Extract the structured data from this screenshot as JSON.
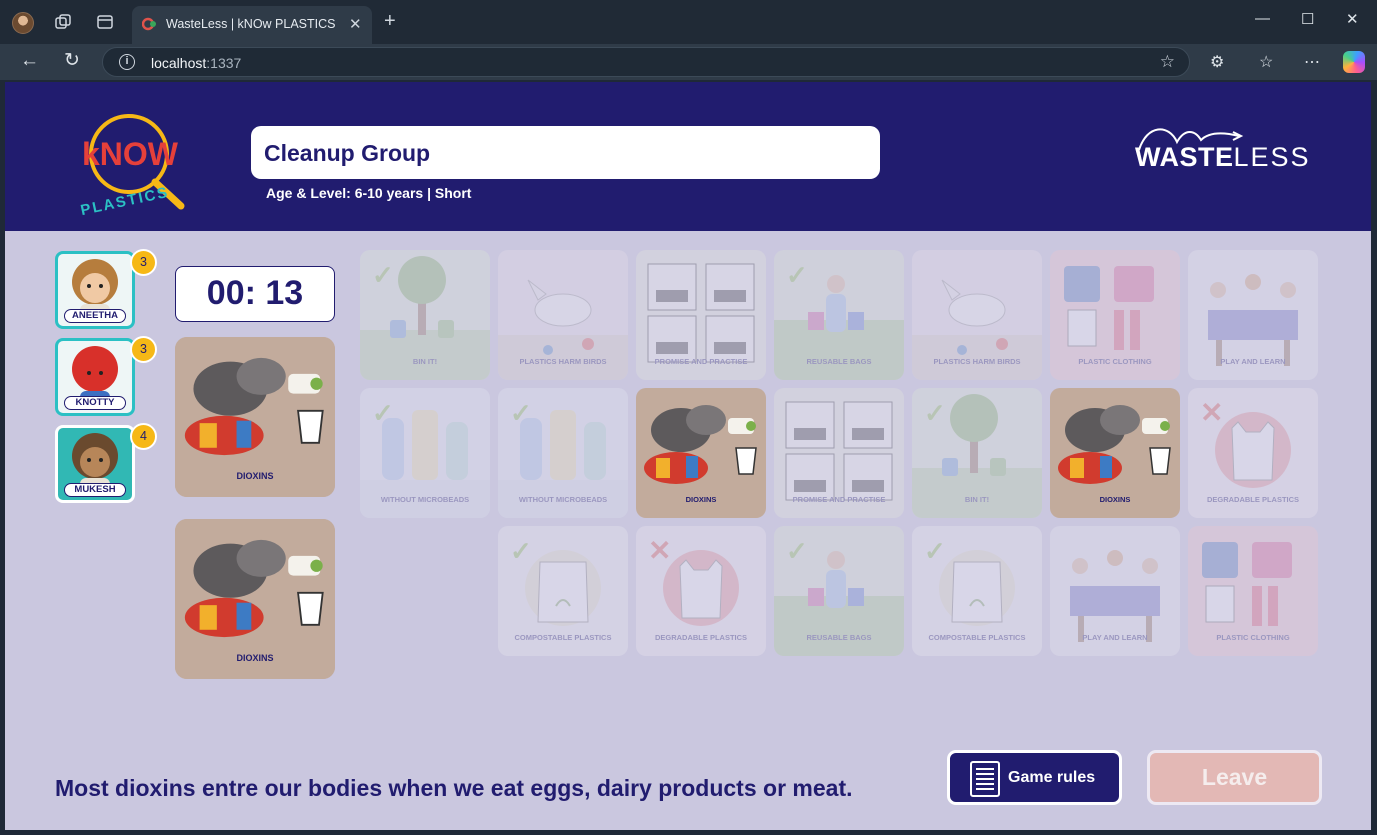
{
  "browser": {
    "tab_title": "WasteLess | kNOw PLASTICS",
    "url_host": "localhost",
    "url_port": ":1337"
  },
  "header": {
    "know_logo_text": "kNOW",
    "know_logo_sub": "PLASTICS",
    "group_name": "Cleanup Group",
    "age_level": "Age & Level: 6-10 years | Short",
    "wasteless_logo_bold": "WASTE",
    "wasteless_logo_light": "LESS"
  },
  "players": [
    {
      "name": "ANEETHA",
      "score": "3",
      "active": true
    },
    {
      "name": "KNOTTY",
      "score": "3",
      "active": true
    },
    {
      "name": "MUKESH",
      "score": "4",
      "active": false
    }
  ],
  "timer": "00: 13",
  "matched_cards": [
    {
      "label": "DIOXINS",
      "theme": "dioxins"
    },
    {
      "label": "DIOXINS",
      "theme": "dioxins"
    }
  ],
  "board": [
    [
      {
        "label": "BIN IT!",
        "theme": "binit",
        "mark": "check",
        "faded": true
      },
      {
        "label": "PLASTICS HARM BIRDS",
        "theme": "birds",
        "mark": "",
        "faded": true
      },
      {
        "label": "PROMISE AND PRACTISE",
        "theme": "promise",
        "mark": "",
        "faded": true
      },
      {
        "label": "REUSABLE BAGS",
        "theme": "bags",
        "mark": "check",
        "faded": true
      },
      {
        "label": "PLASTICS HARM BIRDS",
        "theme": "birds",
        "mark": "",
        "faded": true
      },
      {
        "label": "PLASTIC CLOTHING",
        "theme": "clothing",
        "mark": "",
        "faded": true
      },
      {
        "label": "PLAY AND LEARN",
        "theme": "play",
        "mark": "",
        "faded": true
      }
    ],
    [
      {
        "label": "WITHOUT MICROBEADS",
        "theme": "microbeads",
        "mark": "check",
        "faded": true
      },
      {
        "label": "WITHOUT MICROBEADS",
        "theme": "microbeads",
        "mark": "check",
        "faded": true
      },
      {
        "label": "DIOXINS",
        "theme": "dioxins",
        "mark": "",
        "faded": false
      },
      {
        "label": "PROMISE AND PRACTISE",
        "theme": "promise",
        "mark": "",
        "faded": true
      },
      {
        "label": "BIN IT!",
        "theme": "binit",
        "mark": "check",
        "faded": true
      },
      {
        "label": "DIOXINS",
        "theme": "dioxins",
        "mark": "",
        "faded": false
      },
      {
        "label": "DEGRADABLE PLASTICS",
        "theme": "degradable",
        "mark": "cross",
        "faded": true
      }
    ],
    [
      null,
      {
        "label": "COMPOSTABLE PLASTICS",
        "theme": "compostable",
        "mark": "check",
        "faded": true
      },
      {
        "label": "DEGRADABLE PLASTICS",
        "theme": "degradable",
        "mark": "cross",
        "faded": true
      },
      {
        "label": "REUSABLE BAGS",
        "theme": "bags",
        "mark": "check",
        "faded": true
      },
      {
        "label": "COMPOSTABLE PLASTICS",
        "theme": "compostable",
        "mark": "check",
        "faded": true
      },
      {
        "label": "PLAY AND LEARN",
        "theme": "play",
        "mark": "",
        "faded": true
      },
      {
        "label": "PLASTIC CLOTHING",
        "theme": "clothing",
        "mark": "",
        "faded": true
      }
    ]
  ],
  "fact_text": "Most dioxins entre our bodies when we eat eggs, dairy products or meat.",
  "buttons": {
    "game_rules": "Game rules",
    "leave": "Leave"
  },
  "colors": {
    "navy": "#211c6f",
    "page_bg": "#cac7df",
    "score_badge": "#f6b816",
    "check_green": "#8cc04b",
    "cross_red": "#e0534b",
    "dioxins_card": "#c2ab9c"
  },
  "icons": [
    "profile-avatar-icon",
    "workspaces-icon",
    "tab-actions-icon",
    "close-icon",
    "new-tab-icon",
    "back-icon",
    "refresh-icon",
    "info-icon",
    "favorite-star-icon",
    "extensions-icon",
    "favorites-icon",
    "more-icon",
    "copilot-icon",
    "rules-document-icon",
    "check-icon",
    "cross-icon"
  ]
}
